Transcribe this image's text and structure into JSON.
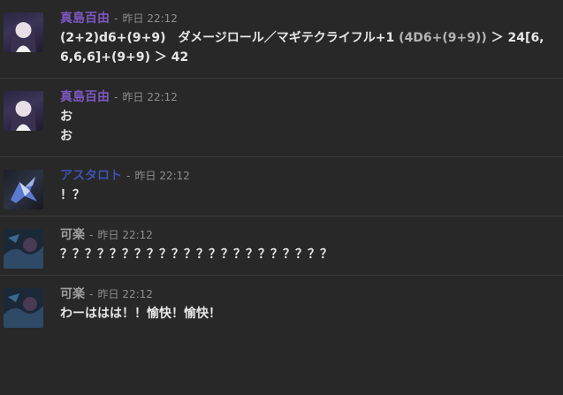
{
  "messages": [
    {
      "user": "真島百由",
      "user_color": "#7e57c2",
      "sep": "-",
      "time": "昨日 22:12",
      "line1_a": "(2+2)d6+(9+9)　ダメージロール／マギテクライフル+1 ",
      "line1_b": "(4D6+(9+9))",
      "line1_c": " ＞ 24[6,6,6,6]+(9+9) ＞ 42"
    },
    {
      "user": "真島百由",
      "user_color": "#7e57c2",
      "sep": "-",
      "time": "昨日 22:12",
      "lines": [
        "お",
        "お"
      ]
    },
    {
      "user": "アスタロト",
      "user_color": "#3f51b5",
      "sep": "-",
      "time": "昨日 22:12",
      "lines": [
        "！？"
      ]
    },
    {
      "user": "可楽",
      "user_color": "#9e9e9e",
      "sep": "-",
      "time": "昨日 22:12",
      "lines": [
        "？？？？？？？？？？？？？？？？？？？？？？"
      ]
    },
    {
      "user": "可楽",
      "user_color": "#9e9e9e",
      "sep": "-",
      "time": "昨日 22:12",
      "lines": [
        "わーははは！！愉快！愉快！"
      ]
    }
  ]
}
